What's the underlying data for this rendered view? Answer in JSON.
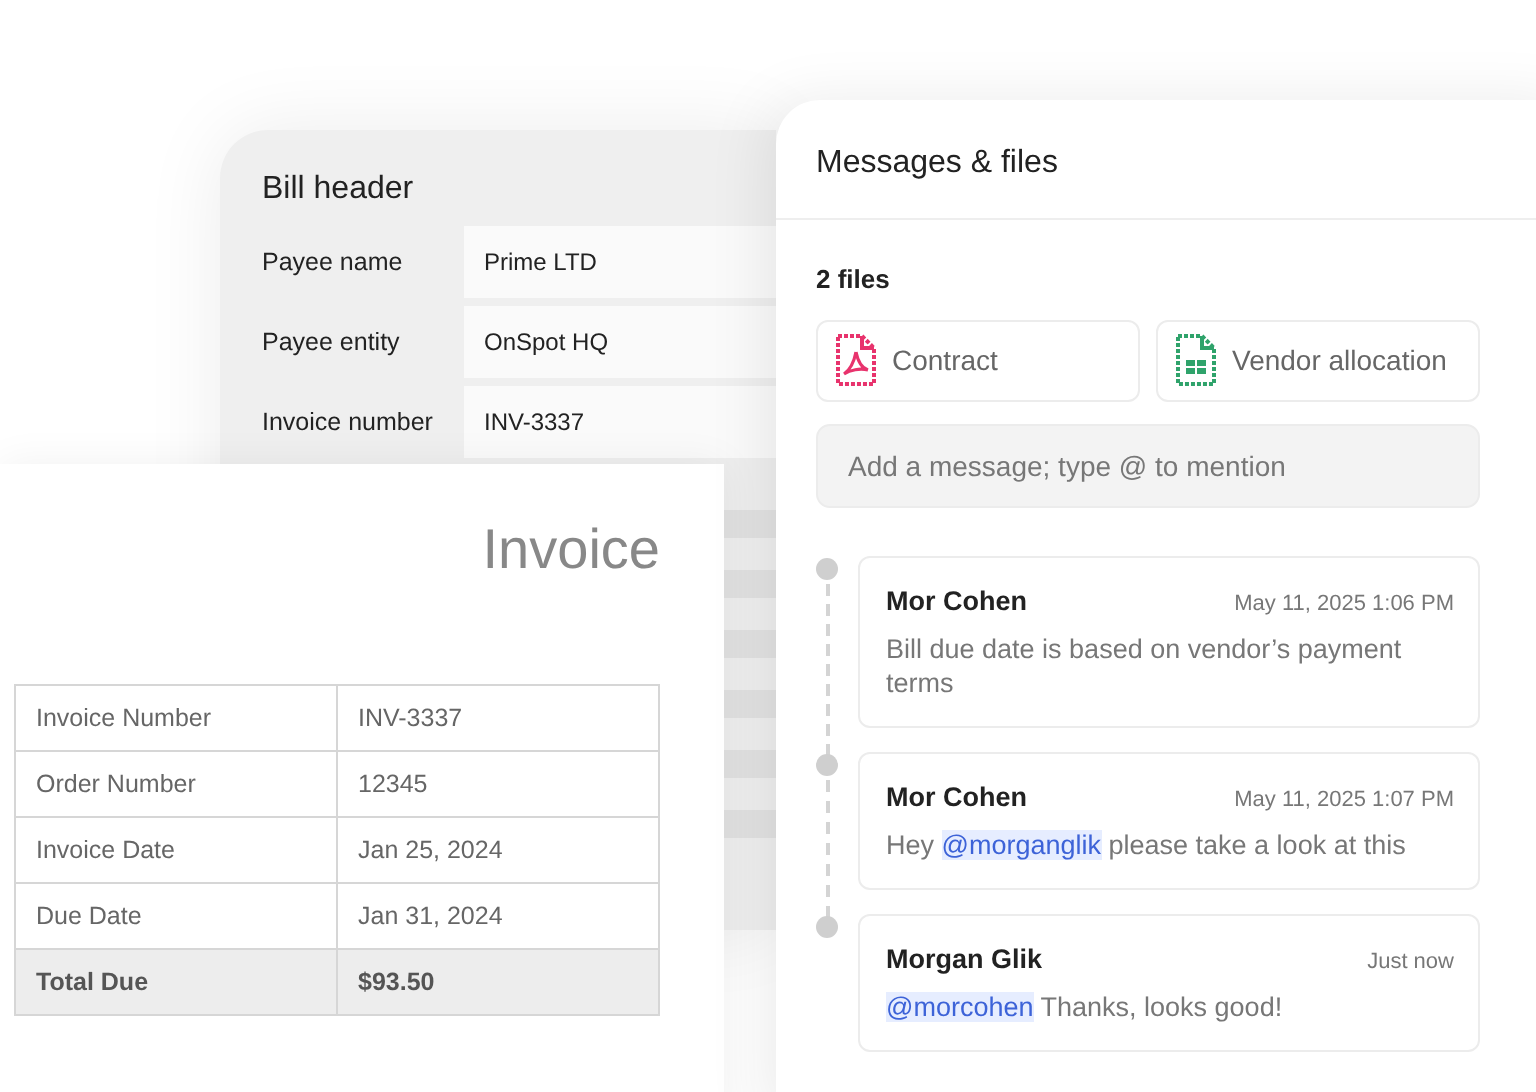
{
  "bill_header": {
    "title": "Bill header",
    "fields": [
      {
        "label": "Payee name",
        "value": "Prime LTD"
      },
      {
        "label": "Payee entity",
        "value": "OnSpot HQ"
      },
      {
        "label": "Invoice number",
        "value": "INV-3337"
      }
    ]
  },
  "invoice": {
    "title": "Invoice",
    "rows": [
      {
        "label": "Invoice Number",
        "value": "INV-3337",
        "total": false
      },
      {
        "label": "Order Number",
        "value": "12345",
        "total": false
      },
      {
        "label": "Invoice Date",
        "value": "Jan 25, 2024",
        "total": false
      },
      {
        "label": "Due Date",
        "value": "Jan 31, 2024",
        "total": false
      },
      {
        "label": "Total Due",
        "value": "$93.50",
        "total": true
      }
    ]
  },
  "messages_panel": {
    "title": "Messages & files",
    "files_count": "2 files",
    "files": [
      {
        "name": "Contract",
        "kind": "pdf"
      },
      {
        "name": "Vendor allocation",
        "kind": "sheet"
      }
    ],
    "message_input": {
      "placeholder": "Add a message; type @ to mention"
    },
    "messages": [
      {
        "author": "Mor Cohen",
        "time": "May 11, 2025 1:06 PM",
        "parts": [
          {
            "kind": "text",
            "text": "Bill due date is based on vendor’s payment terms"
          }
        ]
      },
      {
        "author": "Mor Cohen",
        "time": "May 11, 2025 1:07 PM",
        "parts": [
          {
            "kind": "text",
            "text": "Hey "
          },
          {
            "kind": "mention",
            "text": "@morganglik"
          },
          {
            "kind": "text",
            "text": " please take a look at this"
          }
        ]
      },
      {
        "author": "Morgan Glik",
        "time": "Just now",
        "parts": [
          {
            "kind": "mention",
            "text": "@morcohen"
          },
          {
            "kind": "text",
            "text": " Thanks, looks good!"
          }
        ]
      }
    ]
  }
}
